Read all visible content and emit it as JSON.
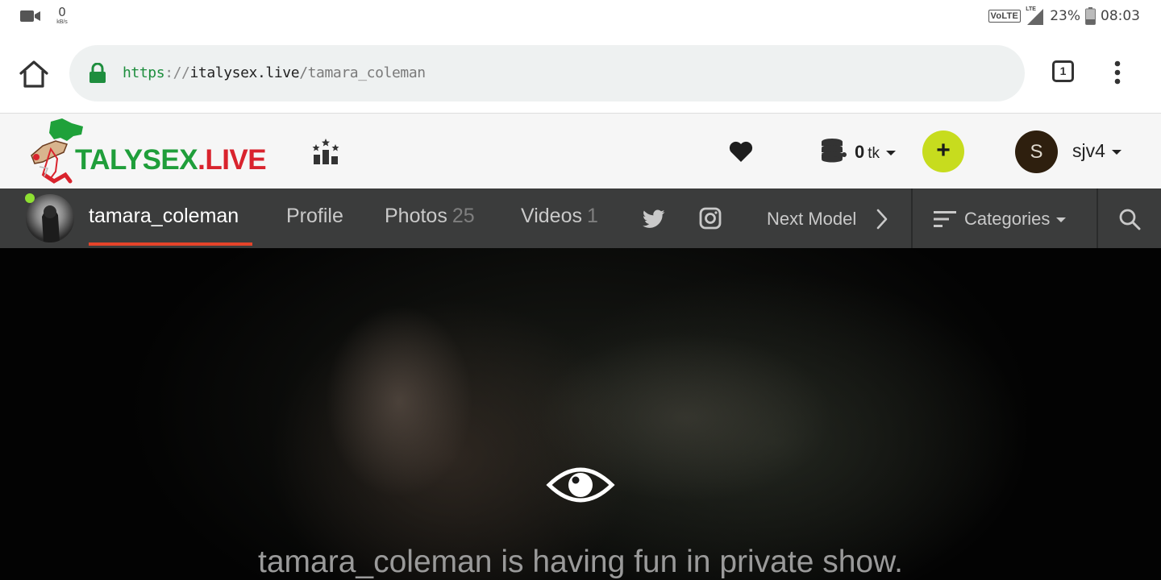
{
  "status_bar": {
    "network_speed_value": "0",
    "network_speed_unit": "kB/s",
    "volte": "VoLTE",
    "signal_type": "LTE",
    "battery": "23%",
    "time": "08:03",
    "icons": [
      "video-camera-icon",
      "signal-icon",
      "battery-icon"
    ]
  },
  "browser": {
    "url_scheme": "https",
    "url_separator": "://",
    "url_domain": "italysex.live",
    "url_path": "/tamara_coleman",
    "tab_count": "1",
    "icons": [
      "home-icon",
      "lock-icon",
      "more-vert-icon"
    ]
  },
  "site_header": {
    "logo_text_a": "TALYSEX",
    "logo_text_b": ".LIVE",
    "token_amount": "0",
    "token_unit": "tk",
    "add_label": "+",
    "avatar_initial": "S",
    "username": "sjv4",
    "icons": [
      "ranking-icon",
      "heart-icon",
      "coins-icon",
      "caret-down-icon"
    ],
    "colors": {
      "add_button": "#c7dc1e",
      "logo_green": "#1f9e3a",
      "logo_red": "#d9232d"
    }
  },
  "model_nav": {
    "model_name": "tamara_coleman",
    "profile_label": "Profile",
    "photos_label": "Photos",
    "photos_count": "25",
    "videos_label": "Videos",
    "videos_count": "1",
    "next_model_label": "Next Model",
    "categories_label": "Categories",
    "icons": [
      "twitter-icon",
      "instagram-icon",
      "chevron-right-icon",
      "filter-icon",
      "search-icon"
    ],
    "colors": {
      "active_underline": "#e4442a",
      "online_dot": "#8ee032",
      "bar": "#3b3c3c"
    }
  },
  "video": {
    "message": "tamara_coleman is having fun in private show.",
    "icons": [
      "eye-icon"
    ]
  }
}
